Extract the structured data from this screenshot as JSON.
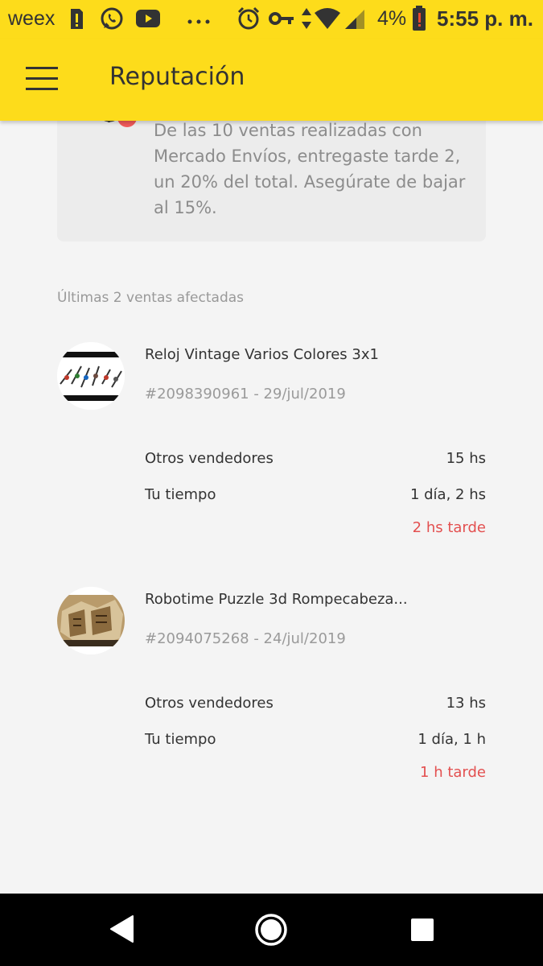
{
  "status_bar": {
    "carrier": "weex",
    "battery_percent": "4%",
    "time": "5:55 p. m.",
    "icons": [
      "sim-alert-icon",
      "whatsapp-icon",
      "youtube-icon",
      "more-icon",
      "alarm-icon",
      "vpn-key-icon",
      "data-arrows-icon",
      "wifi-icon",
      "signal-icon",
      "battery-low-icon"
    ]
  },
  "app_bar": {
    "title": "Reputación",
    "menu_icon": "hamburger-menu-icon"
  },
  "info_card": {
    "text": "De las 10 ventas realizadas con Mercado Envíos, entregaste tarde 2, un 20% del total. Asegúrate de bajar al 15%."
  },
  "section_title": "Últimas 2 ventas afectadas",
  "sales": [
    {
      "title": "Reloj Vintage Varios Colores 3x1",
      "order": "#2098390961 - 29/jul/2019",
      "others_label": "Otros vendedores",
      "others_value": "15 hs",
      "yours_label": "Tu tiempo",
      "yours_value": "1 día, 2 hs",
      "late": "2 hs tarde"
    },
    {
      "title": "Robotime Puzzle 3d Rompecabeza...",
      "order": "#2094075268 - 24/jul/2019",
      "others_label": "Otros vendedores",
      "others_value": "13 hs",
      "yours_label": "Tu tiempo",
      "yours_value": "1 día, 1 h",
      "late": "1 h tarde"
    }
  ],
  "colors": {
    "brand_yellow": "#fddc1b",
    "late_red": "#e35050",
    "background": "#f4f4f4"
  }
}
